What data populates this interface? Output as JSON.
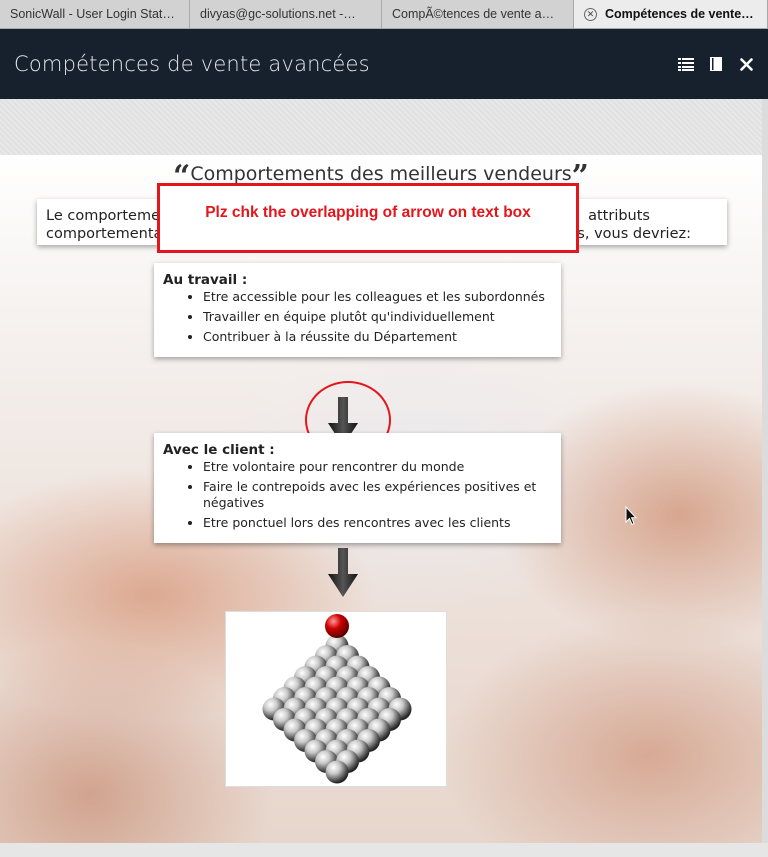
{
  "browser": {
    "tabs": [
      {
        "label": "SonicWall - User Login Stat…",
        "active": false
      },
      {
        "label": "divyas@gc-solutions.net -…",
        "active": false
      },
      {
        "label": "CompÃ©tences de vente a…",
        "active": false
      },
      {
        "label": "Compétences de vente…",
        "active": true
      }
    ]
  },
  "header": {
    "title": "Compétences de vente avancées",
    "icons": [
      "list-icon",
      "bookmark-icon",
      "close-icon"
    ]
  },
  "slide": {
    "title": "Comportements des meilleurs vendeurs",
    "open_quote": "“",
    "close_quote": "”",
    "intro_left_line1": "Le comportemer",
    "intro_left_line2": "comportementa",
    "intro_right_line1": "attributs",
    "intro_right_line2": "us, vous devriez:",
    "annotation": "Plz chk the overlapping of arrow on text box",
    "work": {
      "heading": "Au travail :",
      "items": [
        "Etre accessible pour les colleagues et les subordonnés",
        "Travailler en équipe plutôt qu'individuellement",
        "Contribuer à la réussite du Département"
      ]
    },
    "client": {
      "heading": "Avec le client :",
      "items": [
        "Etre volontaire pour rencontrer du monde",
        "Faire le contrepoids avec les expériences positives et négatives",
        "Etre ponctuel lors des rencontres avec les clients"
      ]
    }
  },
  "colors": {
    "header_bg": "#17212e",
    "annotation_red": "#e3161b"
  }
}
